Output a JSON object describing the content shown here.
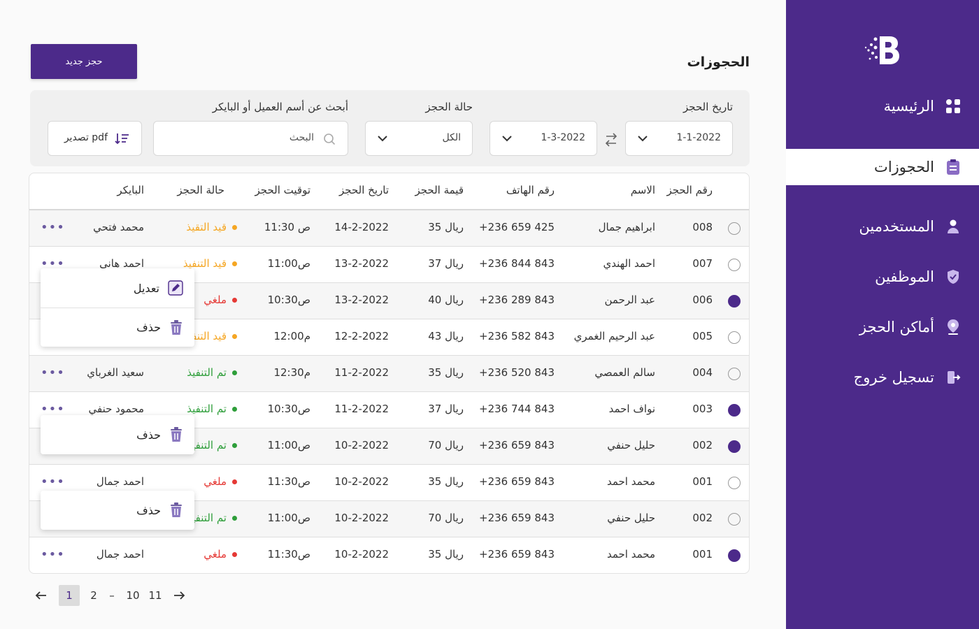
{
  "sidebar": {
    "items": [
      {
        "label": "الرئيسية",
        "icon": "grid-icon"
      },
      {
        "label": "الحجوزات",
        "icon": "clipboard-icon",
        "active": true
      },
      {
        "label": "المستخدمين",
        "icon": "user-icon"
      },
      {
        "label": "الموظفين",
        "icon": "shield-icon"
      },
      {
        "label": "أماكن الحجز",
        "icon": "location-pin-icon"
      },
      {
        "label": "تسجيل خروج",
        "icon": "logout-icon"
      }
    ]
  },
  "header": {
    "title": "الحجوزات",
    "new_booking_label": "حجز جديد"
  },
  "filters": {
    "date_label": "تاريخ الحجز",
    "date_from": "1-1-2022",
    "date_to": "1-3-2022",
    "status_label": "حالة الحجز",
    "status_value": "الكل",
    "search_label": "أبحث عن أسم العميل أو البايكر",
    "search_placeholder": "البحث",
    "export_label": "تصدير pdf"
  },
  "table": {
    "headers": {
      "number": "رقم الحجز",
      "name": "الاسم",
      "phone": "رقم الهاتف",
      "amount": "قيمة الحجز",
      "date": "تاريخ الحجز",
      "time": "توقيت الحجز",
      "status": "حالة الحجز",
      "biker": "البايكر"
    },
    "rows": [
      {
        "checked": false,
        "number": "008",
        "name": "ابراهيم جمال",
        "phone": "+236 659 425",
        "amount": "35 ريال",
        "date": "14-2-2022",
        "time": "11:30 ص",
        "status": "قيد التقيذ",
        "status_color": "#f5a623",
        "biker": "محمد فتحي",
        "more": "•••"
      },
      {
        "checked": false,
        "number": "007",
        "name": "احمد الهندي",
        "phone": "+236 844 843",
        "amount": "37 ريال",
        "date": "13-2-2022",
        "time": "11:00ص",
        "status": "قيد التنفيذ",
        "status_color": "#f5a623",
        "biker": "احمد هاني",
        "more": "•••"
      },
      {
        "checked": true,
        "number": "006",
        "name": "عبد الرحمن",
        "phone": "+236 289 843",
        "amount": "40 ريال",
        "date": "13-2-2022",
        "time": "10:30ص",
        "status": "ملغي",
        "status_color": "#e53935",
        "biker": "",
        "more": ""
      },
      {
        "checked": false,
        "number": "005",
        "name": "عبد الرحيم الغمري",
        "phone": "+236 582 843",
        "amount": "43 ريال",
        "date": "12-2-2022",
        "time": "12:00م",
        "status": "قيد التنفيذ",
        "status_color": "#f5a623",
        "biker": "",
        "more": ""
      },
      {
        "checked": false,
        "number": "004",
        "name": "سالم العمصي",
        "phone": "+236 520 843",
        "amount": "35 ريال",
        "date": "11-2-2022",
        "time": "12:30م",
        "status": "تم التنفيذ",
        "status_color": "#2e9e3a",
        "biker": "سعيد الغرباي",
        "more": "•••"
      },
      {
        "checked": true,
        "number": "003",
        "name": "نواف احمد",
        "phone": "+236 744 843",
        "amount": "37 ريال",
        "date": "11-2-2022",
        "time": "10:30ص",
        "status": "تم التنفيذ",
        "status_color": "#2e9e3a",
        "biker": "محمود حنفي",
        "more": "•••"
      },
      {
        "checked": true,
        "number": "002",
        "name": "حليل حنفي",
        "phone": "+236 659 843",
        "amount": "70 ريال",
        "date": "10-2-2022",
        "time": "11:00ص",
        "status": "تم التنفيذ",
        "status_color": "#2e9e3a",
        "biker": "",
        "more": ""
      },
      {
        "checked": false,
        "number": "001",
        "name": "محمد احمد",
        "phone": "+236 659 843",
        "amount": "35 ريال",
        "date": "10-2-2022",
        "time": "11:30ص",
        "status": "ملغي",
        "status_color": "#e53935",
        "biker": "احمد جمال",
        "more": "•••"
      },
      {
        "checked": false,
        "number": "002",
        "name": "حليل حنفي",
        "phone": "+236 659 843",
        "amount": "70 ريال",
        "date": "10-2-2022",
        "time": "11:00ص",
        "status": "تم التنفيذ",
        "status_color": "#2e9e3a",
        "biker": "",
        "more": ""
      },
      {
        "checked": true,
        "number": "001",
        "name": "محمد احمد",
        "phone": "+236 659 843",
        "amount": "35 ريال",
        "date": "10-2-2022",
        "time": "11:30ص",
        "status": "ملغي",
        "status_color": "#e53935",
        "biker": "احمد جمال",
        "more": "•••"
      }
    ]
  },
  "popups": {
    "edit_label": "تعديل",
    "delete_label": "حذف"
  },
  "pagination": {
    "pages": [
      "1",
      "2",
      "–",
      "10",
      "11"
    ],
    "current": "1"
  },
  "colors": {
    "brand": "#4c2a8a",
    "pending": "#f5a623",
    "done": "#2e9e3a",
    "cancelled": "#e53935"
  }
}
